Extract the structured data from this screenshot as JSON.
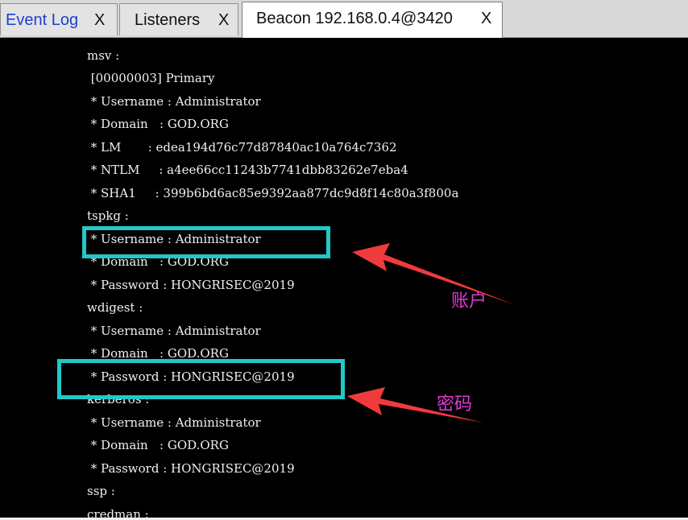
{
  "tabs": [
    {
      "label": "Event Log",
      "close": "X"
    },
    {
      "label": "Listeners",
      "close": "X"
    },
    {
      "label": "Beacon 192.168.0.4@3420",
      "close": "X"
    }
  ],
  "console": {
    "lines": [
      "msv :",
      " [00000003] Primary",
      " * Username : Administrator",
      " * Domain   : GOD.ORG",
      " * LM       : edea194d76c77d87840ac10a764c7362",
      " * NTLM     : a4ee66cc11243b7741dbb83262e7eba4",
      " * SHA1     : 399b6bd6ac85e9392aa877dc9d8f14c80a3f800a",
      "tspkg :",
      " * Username : Administrator",
      " * Domain   : GOD.ORG",
      " * Password : HONGRISEC@2019",
      "wdigest :",
      " * Username : Administrator",
      " * Domain   : GOD.ORG",
      " * Password : HONGRISEC@2019",
      "kerberos :",
      " * Username : Administrator",
      " * Domain   : GOD.ORG",
      " * Password : HONGRISEC@2019",
      "ssp :",
      "credman :"
    ]
  },
  "annotations": {
    "account_label": "账户",
    "password_label": "密码",
    "box_color": "#22c8c8",
    "arrow_color": "#ef3b3b",
    "label_color": "#e13bd6"
  }
}
